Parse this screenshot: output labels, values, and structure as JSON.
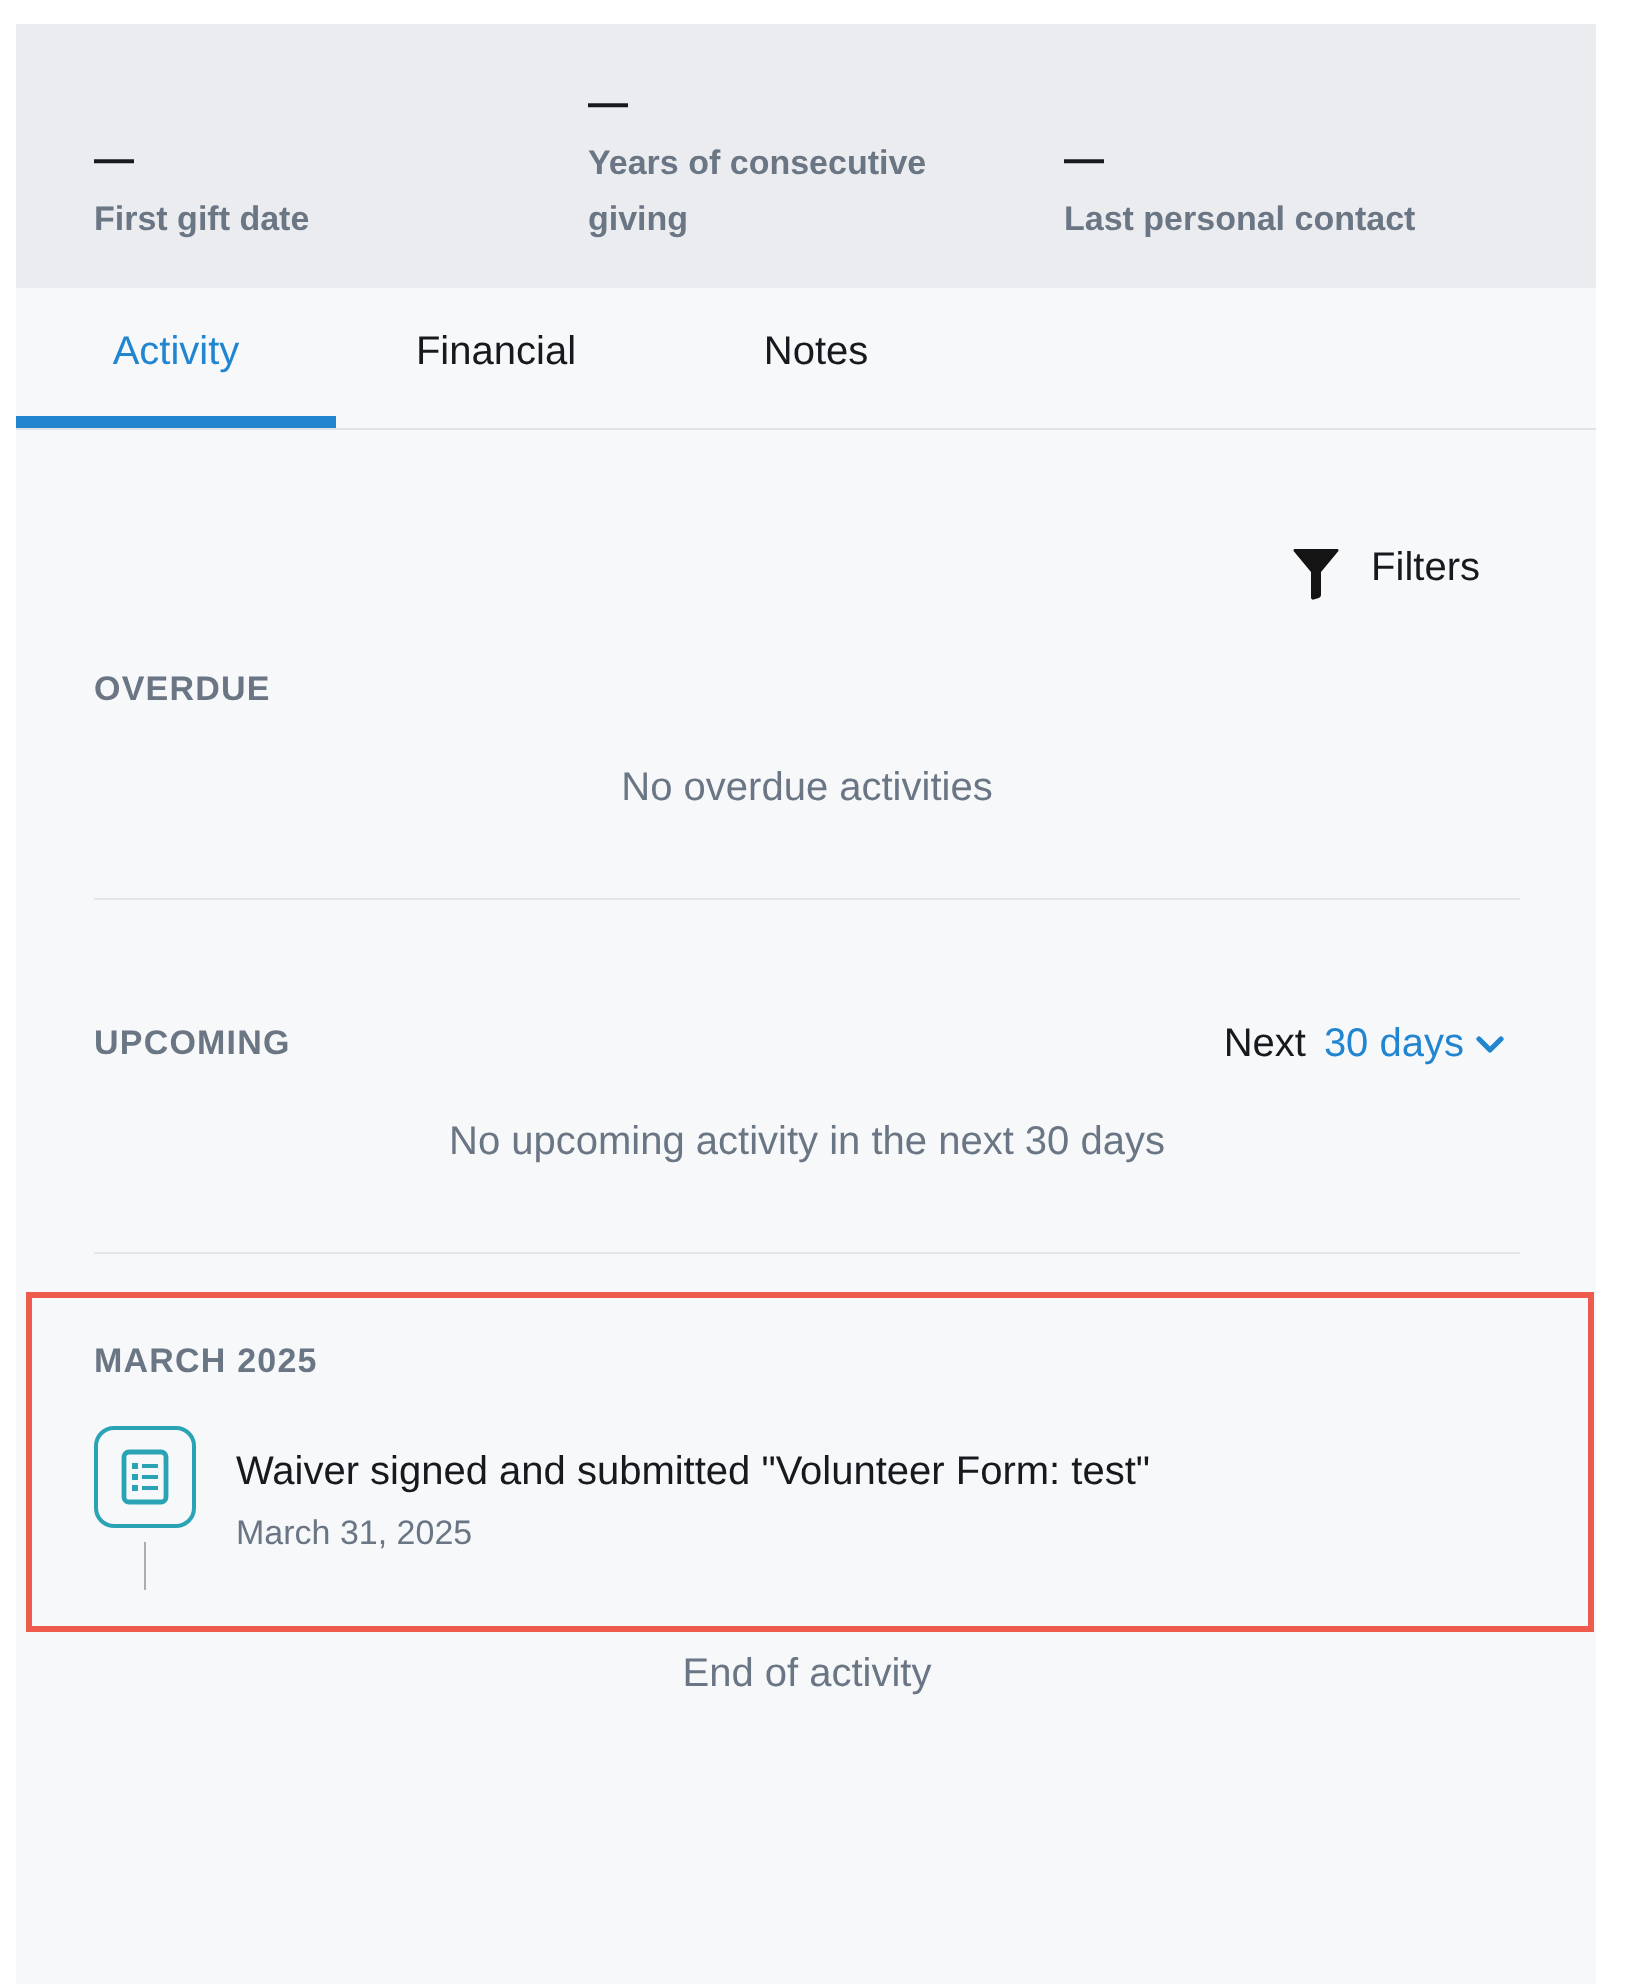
{
  "stats": [
    {
      "value": "—",
      "label": "First gift date"
    },
    {
      "value": "—",
      "label": "Years of consecutive giving"
    },
    {
      "value": "—",
      "label": "Last personal contact"
    }
  ],
  "tabs": [
    {
      "label": "Activity",
      "selected": true
    },
    {
      "label": "Financial",
      "selected": false
    },
    {
      "label": "Notes",
      "selected": false
    }
  ],
  "filters_button": {
    "label": "Filters"
  },
  "sections": [
    {
      "kind": "overdue",
      "heading": "OVERDUE",
      "empty_message": "No overdue activities"
    },
    {
      "kind": "upcoming",
      "heading": "UPCOMING",
      "range": {
        "prefix": "Next",
        "value": "30 days"
      },
      "empty_message": "No upcoming activity in the next 30 days"
    }
  ],
  "months": [
    {
      "heading": "MARCH 2025",
      "highlighted": true,
      "items": [
        {
          "title": "Waiver signed and submitted \"Volunteer Form: test\"",
          "date": "March 31, 2025"
        }
      ]
    }
  ],
  "end_message": "End of activity"
}
